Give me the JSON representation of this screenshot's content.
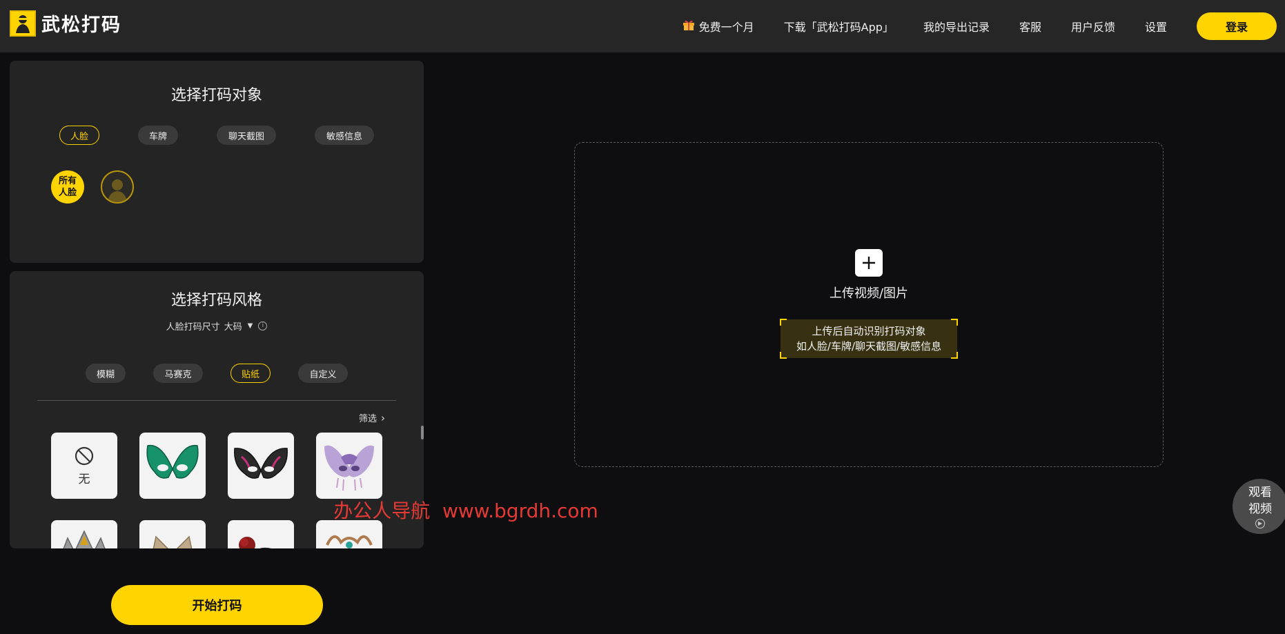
{
  "header": {
    "logo_text": "武松打码",
    "nav": {
      "free_month": "免费一个月",
      "download_app": "下载「武松打码App」",
      "export_history": "我的导出记录",
      "service": "客服",
      "feedback": "用户反馈",
      "settings": "设置"
    },
    "login_label": "登录"
  },
  "target_panel": {
    "title": "选择打码对象",
    "tabs": [
      "人脸",
      "车牌",
      "聊天截图",
      "敏感信息"
    ],
    "active_tab": "人脸",
    "all_faces_label": "所有人脸"
  },
  "style_panel": {
    "title": "选择打码风格",
    "face_size_label": "人脸打码尺寸",
    "face_size_value": "大码",
    "styles": [
      "模糊",
      "马赛克",
      "贴纸",
      "自定义"
    ],
    "active_style": "贴纸",
    "filter_label": "筛选",
    "none_label": "无",
    "stickers": [
      {
        "icon": "green-butterfly-mask-icon"
      },
      {
        "icon": "black-butterfly-mask-icon"
      },
      {
        "icon": "purple-butterfly-mask-icon"
      },
      {
        "icon": "silver-crown-mask-icon"
      },
      {
        "icon": "cat-mask-icon"
      },
      {
        "icon": "rose-mask-icon"
      },
      {
        "icon": "ornate-gold-mask-icon"
      }
    ]
  },
  "start_label": "开始打码",
  "upload": {
    "label": "上传视频/图片",
    "hint_line1": "上传后自动识别打码对象",
    "hint_line2": "如人脸/车牌/聊天截图/敏感信息"
  },
  "watermark": "办公人导航  www.bgrdh.com",
  "watch_video": {
    "line1": "观看",
    "line2": "视频"
  },
  "colors": {
    "accent": "#ffd400",
    "background": "#0e0e10",
    "panel": "#242424",
    "header": "#262626",
    "watermark": "#e53935"
  }
}
